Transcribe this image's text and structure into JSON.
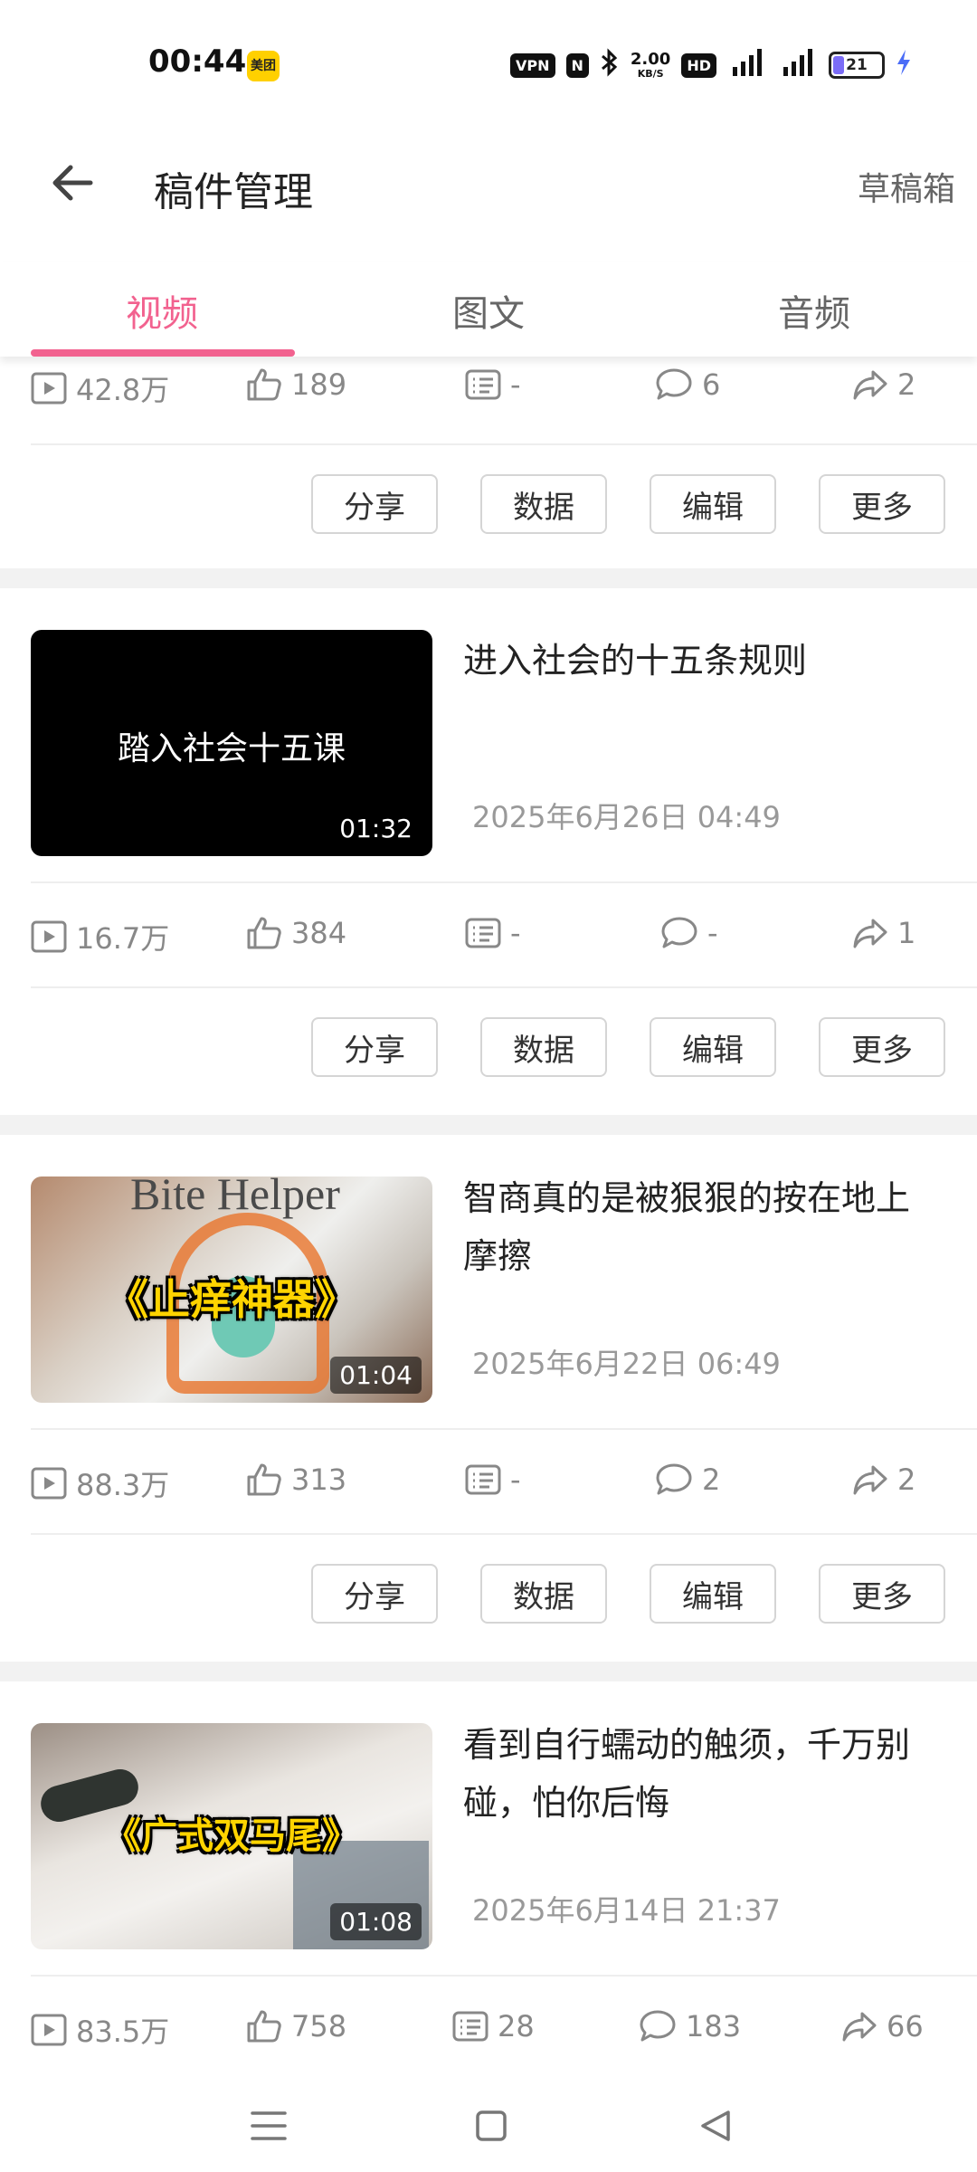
{
  "status_bar": {
    "time": "00:44",
    "app_badge": "美团",
    "vpn": "VPN",
    "nfc": "N",
    "speed_value": "2.00",
    "speed_unit": "KB/S",
    "hd": "HD",
    "sig1": "⁴ᴳ",
    "sig2": "⁴ᴳ",
    "battery": "21"
  },
  "header": {
    "title": "稿件管理",
    "draft_link": "草稿箱"
  },
  "tabs": [
    {
      "label": "视频",
      "active": true
    },
    {
      "label": "图文",
      "active": false
    },
    {
      "label": "音频",
      "active": false
    }
  ],
  "buttons": {
    "share": "分享",
    "data": "数据",
    "edit": "编辑",
    "more": "更多"
  },
  "posts": [
    {
      "title": "",
      "date": "",
      "views": "42.8万",
      "likes": "189",
      "danmaku": "-",
      "comments": "6",
      "shares": "2"
    },
    {
      "thumb_caption": "踏入社会十五课",
      "duration": "01:32",
      "title": "进入社会的十五条规则",
      "date": "2025年6月26日 04:49",
      "views": "16.7万",
      "likes": "384",
      "danmaku": "-",
      "comments": "-",
      "shares": "1"
    },
    {
      "thumb_caption": "《止痒神器》",
      "thumb_top_text": "Bite Helper",
      "duration": "01:04",
      "title": "智商真的是被狠狠的按在地上摩擦",
      "date": "2025年6月22日 06:49",
      "views": "88.3万",
      "likes": "313",
      "danmaku": "-",
      "comments": "2",
      "shares": "2"
    },
    {
      "thumb_caption": "《广式双马尾》",
      "duration": "01:08",
      "title": "看到自行蠕动的触须，千万别碰，怕你后悔",
      "date": "2025年6月14日 21:37",
      "views": "83.5万",
      "likes": "758",
      "danmaku": "28",
      "comments": "183",
      "shares": "66"
    }
  ],
  "colors": {
    "accent": "#f2628f",
    "muted_text": "#888888",
    "divider": "#eeeeee",
    "section_gap": "#f2f2f2"
  }
}
